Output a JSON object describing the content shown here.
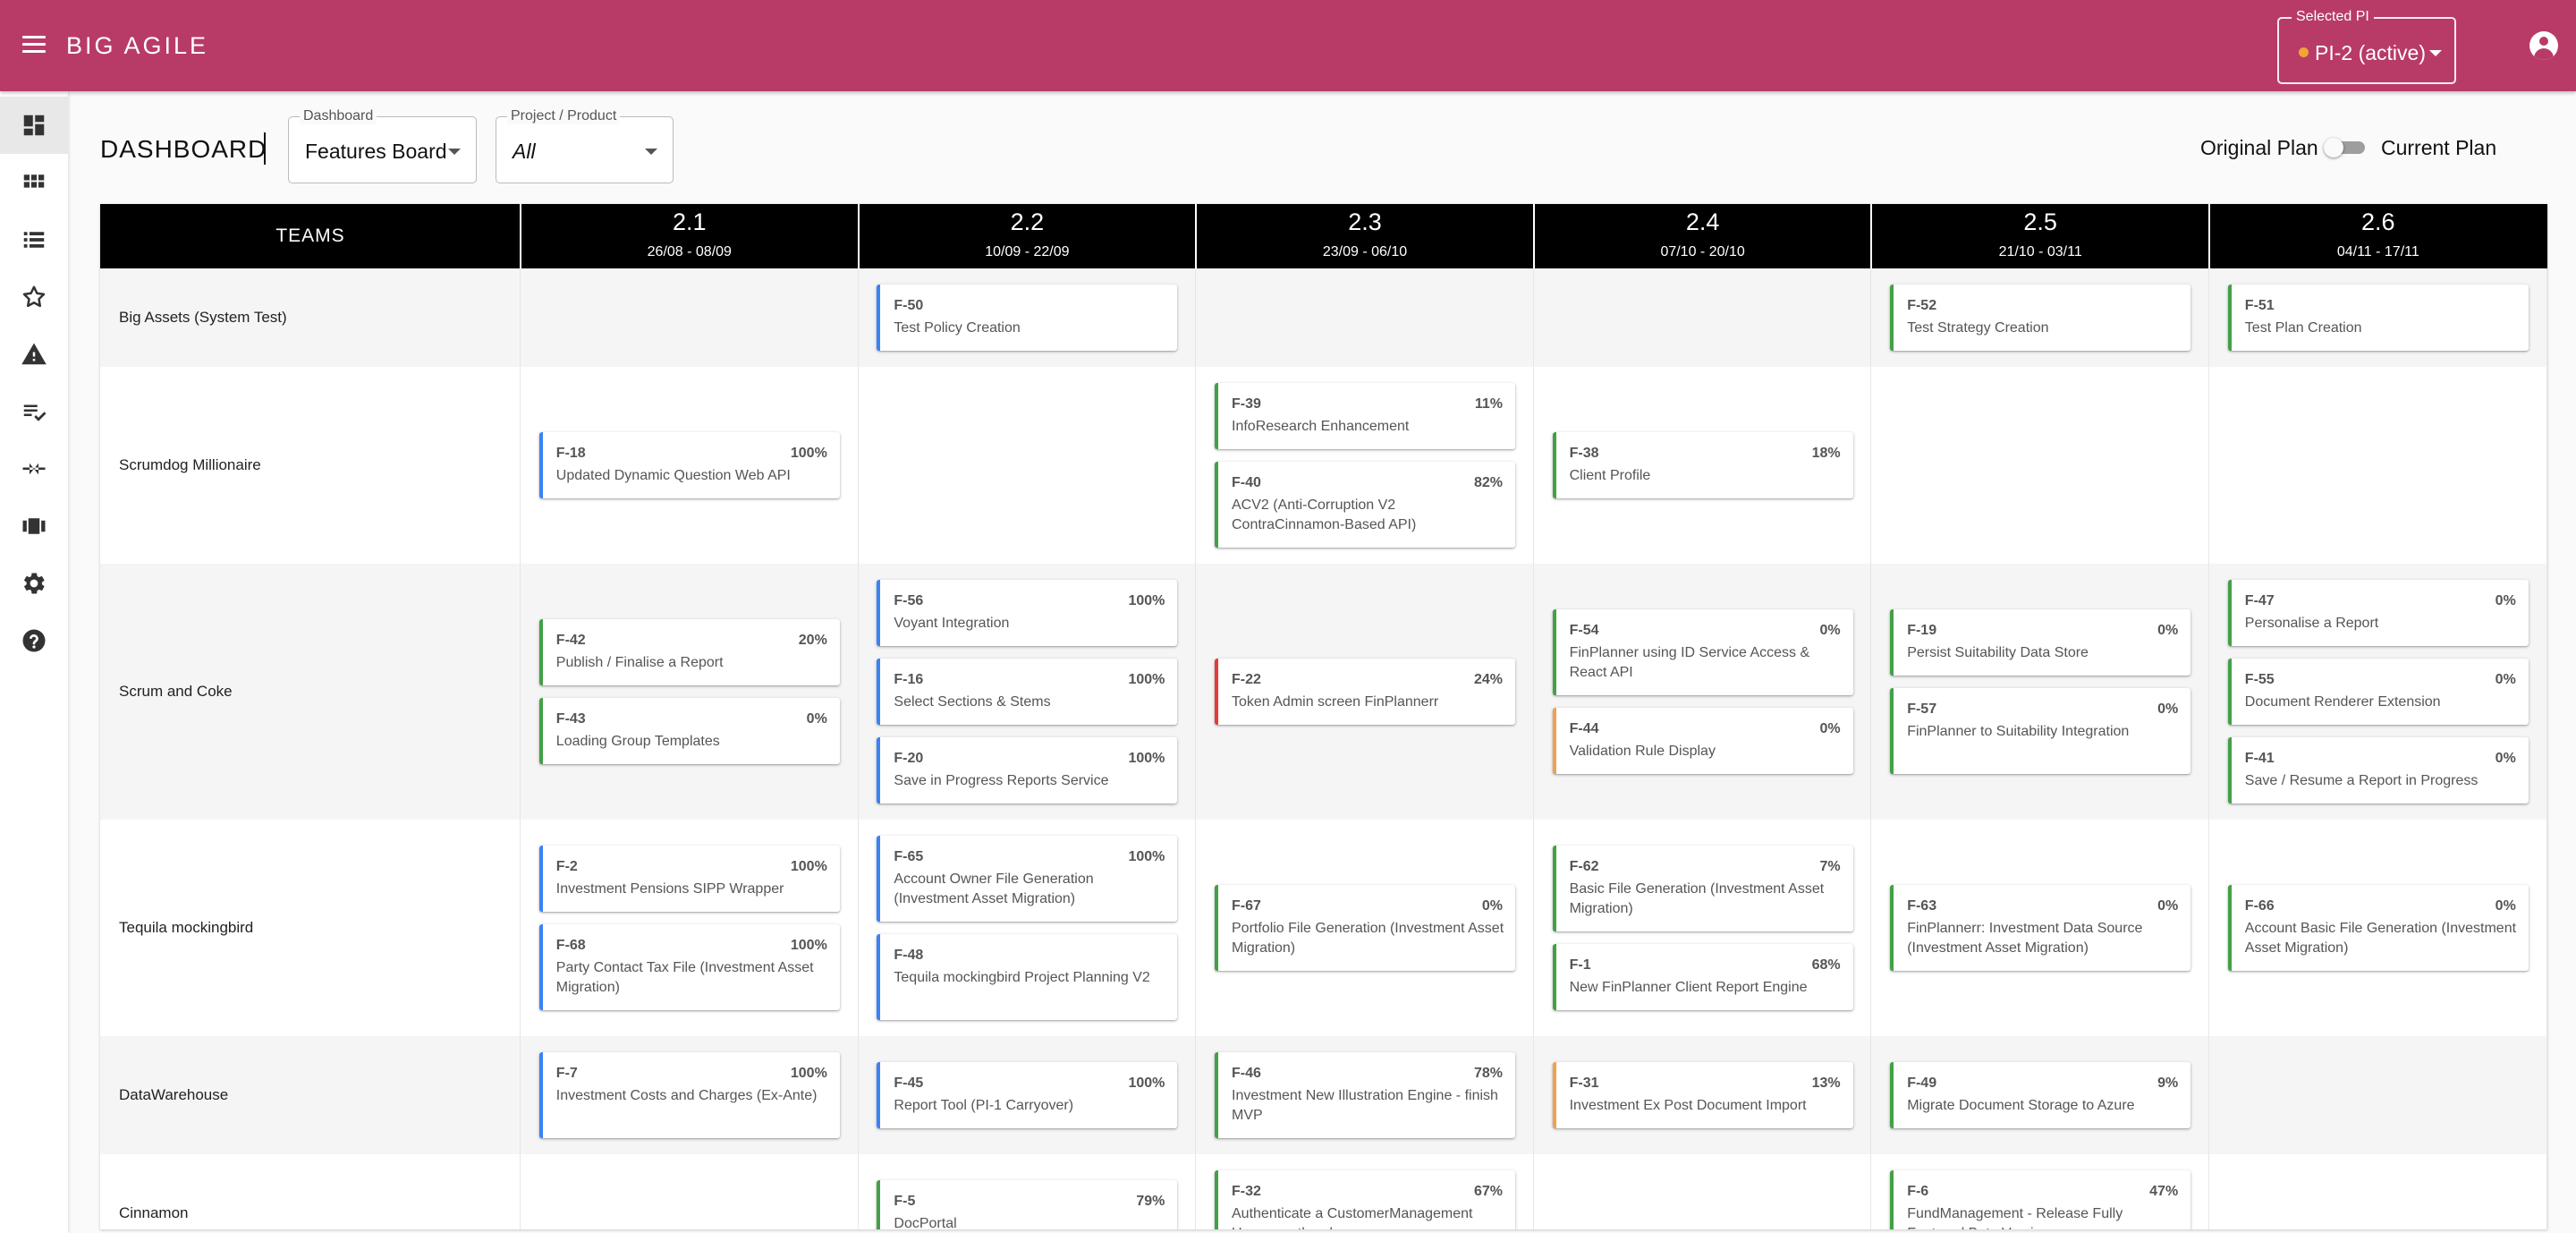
{
  "app": {
    "title": "BIG AGILE"
  },
  "selected_pi": {
    "label": "Selected PI",
    "value": "PI-2 (active)",
    "status_color": "#f0a438"
  },
  "colors": {
    "brand": "#b83b67",
    "border_blue": "#3b82f6",
    "border_green": "#43a047",
    "border_red": "#e53935",
    "border_orange": "#f0a050"
  },
  "sidebar": {
    "items": [
      {
        "icon": "dashboard-icon",
        "active": true
      },
      {
        "icon": "grid-icon",
        "active": false
      },
      {
        "icon": "list-icon",
        "active": false
      },
      {
        "icon": "star-icon",
        "active": false
      },
      {
        "icon": "warning-icon",
        "active": false
      },
      {
        "icon": "checklist-icon",
        "active": false
      },
      {
        "icon": "merge-icon",
        "active": false
      },
      {
        "icon": "panels-icon",
        "active": false
      },
      {
        "icon": "gear-icon",
        "active": false
      },
      {
        "icon": "help-icon",
        "active": false
      }
    ]
  },
  "page": {
    "title": "DASHBOARD",
    "dashboard_select": {
      "label": "Dashboard",
      "value": "Features Board"
    },
    "project_select": {
      "label": "Project / Product",
      "value": "All"
    },
    "plan_toggle": {
      "left_label": "Original Plan",
      "right_label": "Current Plan",
      "on": false
    }
  },
  "board": {
    "teams_header": "TEAMS",
    "iterations": [
      {
        "num": "2.1",
        "dates": "26/08 - 08/09"
      },
      {
        "num": "2.2",
        "dates": "10/09 - 22/09"
      },
      {
        "num": "2.3",
        "dates": "23/09 - 06/10"
      },
      {
        "num": "2.4",
        "dates": "07/10 - 20/10"
      },
      {
        "num": "2.5",
        "dates": "21/10 - 03/11"
      },
      {
        "num": "2.6",
        "dates": "04/11 - 17/11"
      }
    ],
    "teams": [
      {
        "name": "Big Assets (System Test)",
        "cells": [
          [],
          [
            {
              "id": "F-50",
              "title": "Test Policy Creation",
              "pct": "",
              "color": "blue"
            }
          ],
          [],
          [],
          [
            {
              "id": "F-52",
              "title": "Test Strategy Creation",
              "pct": "",
              "color": "green"
            }
          ],
          [
            {
              "id": "F-51",
              "title": "Test Plan Creation",
              "pct": "",
              "color": "green"
            }
          ]
        ]
      },
      {
        "name": "Scrumdog Millionaire",
        "cells": [
          [
            {
              "id": "F-18",
              "title": "Updated Dynamic Question Web API",
              "pct": "100%",
              "color": "blue"
            }
          ],
          [],
          [
            {
              "id": "F-39",
              "title": "InfoResearch Enhancement",
              "pct": "11%",
              "color": "green"
            },
            {
              "id": "F-40",
              "title": "ACV2 (Anti-Corruption V2 ContraCinnamon-Based API)",
              "pct": "82%",
              "color": "green"
            }
          ],
          [
            {
              "id": "F-38",
              "title": "Client Profile",
              "pct": "18%",
              "color": "green"
            }
          ],
          [],
          []
        ]
      },
      {
        "name": "Scrum and Coke",
        "cells": [
          [
            {
              "id": "F-42",
              "title": "Publish / Finalise a Report",
              "pct": "20%",
              "color": "green"
            },
            {
              "id": "F-43",
              "title": "Loading Group Templates",
              "pct": "0%",
              "color": "green"
            }
          ],
          [
            {
              "id": "F-56",
              "title": "Voyant Integration",
              "pct": "100%",
              "color": "blue"
            },
            {
              "id": "F-16",
              "title": "Select Sections & Stems",
              "pct": "100%",
              "color": "blue"
            },
            {
              "id": "F-20",
              "title": "Save in Progress Reports Service",
              "pct": "100%",
              "color": "blue"
            }
          ],
          [
            {
              "id": "F-22",
              "title": "Token Admin screen FinPlannerr",
              "pct": "24%",
              "color": "red"
            }
          ],
          [
            {
              "id": "F-54",
              "title": "FinPlanner using ID Service Access & React API",
              "pct": "0%",
              "color": "green"
            },
            {
              "id": "F-44",
              "title": "Validation Rule Display",
              "pct": "0%",
              "color": "orange"
            }
          ],
          [
            {
              "id": "F-19",
              "title": "Persist Suitability Data Store",
              "pct": "0%",
              "color": "green"
            },
            {
              "id": "F-57",
              "title": "FinPlanner to Suitability Integration",
              "pct": "0%",
              "color": "green"
            }
          ],
          [
            {
              "id": "F-47",
              "title": "Personalise a Report",
              "pct": "0%",
              "color": "green"
            },
            {
              "id": "F-55",
              "title": "Document Renderer Extension",
              "pct": "0%",
              "color": "green"
            },
            {
              "id": "F-41",
              "title": "Save / Resume a Report in Progress",
              "pct": "0%",
              "color": "green"
            }
          ]
        ]
      },
      {
        "name": "Tequila mockingbird",
        "cells": [
          [
            {
              "id": "F-2",
              "title": "Investment Pensions SIPP Wrapper",
              "pct": "100%",
              "color": "blue"
            },
            {
              "id": "F-68",
              "title": "Party Contact Tax File (Investment Asset Migration)",
              "pct": "100%",
              "color": "blue"
            }
          ],
          [
            {
              "id": "F-65",
              "title": "Account Owner File Generation (Investment Asset Migration)",
              "pct": "100%",
              "color": "blue"
            },
            {
              "id": "F-48",
              "title": "Tequila mockingbird Project Planning V2",
              "pct": "",
              "color": "blue"
            }
          ],
          [
            {
              "id": "F-67",
              "title": "Portfolio File Generation (Investment Asset Migration)",
              "pct": "0%",
              "color": "green"
            }
          ],
          [
            {
              "id": "F-62",
              "title": "Basic File Generation (Investment Asset Migration)",
              "pct": "7%",
              "color": "green"
            },
            {
              "id": "F-1",
              "title": "New FinPlanner Client Report Engine",
              "pct": "68%",
              "color": "green"
            }
          ],
          [
            {
              "id": "F-63",
              "title": "FinPlannerr: Investment Data Source (Investment Asset Migration)",
              "pct": "0%",
              "color": "green"
            }
          ],
          [
            {
              "id": "F-66",
              "title": "Account Basic File Generation (Investment Asset Migration)",
              "pct": "0%",
              "color": "green"
            }
          ]
        ]
      },
      {
        "name": "DataWarehouse",
        "cells": [
          [
            {
              "id": "F-7",
              "title": "Investment Costs and Charges (Ex-Ante)",
              "pct": "100%",
              "color": "blue"
            }
          ],
          [
            {
              "id": "F-45",
              "title": "Report Tool (PI-1 Carryover)",
              "pct": "100%",
              "color": "blue"
            }
          ],
          [
            {
              "id": "F-46",
              "title": "Investment New Illustration Engine - finish MVP",
              "pct": "78%",
              "color": "green"
            }
          ],
          [
            {
              "id": "F-31",
              "title": "Investment Ex Post Document Import",
              "pct": "13%",
              "color": "orange"
            }
          ],
          [
            {
              "id": "F-49",
              "title": "Migrate Document Storage to Azure",
              "pct": "9%",
              "color": "green"
            }
          ],
          []
        ]
      },
      {
        "name": "Cinnamon",
        "cells": [
          [],
          [
            {
              "id": "F-5",
              "title": "DocPortal",
              "pct": "79%",
              "color": "green"
            }
          ],
          [
            {
              "id": "F-32",
              "title": "Authenticate a CustomerManagement User over the phone",
              "pct": "67%",
              "color": "green"
            }
          ],
          [],
          [
            {
              "id": "F-6",
              "title": "FundManagement - Release Fully Featured Beta Version",
              "pct": "47%",
              "color": "green"
            }
          ],
          []
        ]
      }
    ]
  }
}
